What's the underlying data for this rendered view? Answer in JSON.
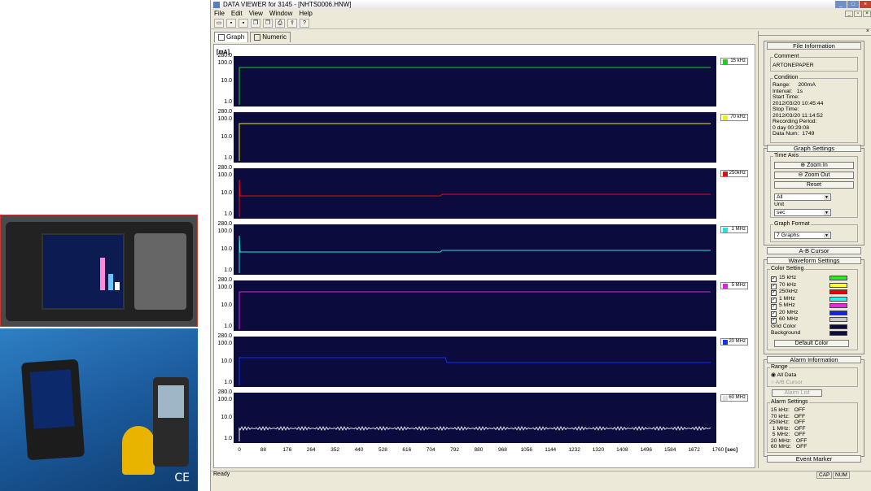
{
  "window": {
    "title": "DATA VIEWER for 3145 - [NHTS0006.HNW]"
  },
  "menu": [
    "File",
    "Edit",
    "View",
    "Window",
    "Help"
  ],
  "tabs": [
    {
      "label": "Graph"
    },
    {
      "label": "Numeric"
    }
  ],
  "graph": {
    "unit": "[mA]",
    "y_ticks": [
      "280.0",
      "100.0",
      "10.0",
      "1.0"
    ],
    "x_ticks": [
      "0",
      "88",
      "176",
      "264",
      "352",
      "440",
      "528",
      "616",
      "704",
      "792",
      "880",
      "968",
      "1056",
      "1144",
      "1232",
      "1320",
      "1408",
      "1496",
      "1584",
      "1672",
      "1760"
    ],
    "x_unit": "[sec]",
    "channels": [
      {
        "label": "15 kHz",
        "color": "#22cc22"
      },
      {
        "label": "70 kHz",
        "color": "#eeee22"
      },
      {
        "label": "250kHz",
        "color": "#dd1111"
      },
      {
        "label": "1 MHz",
        "color": "#33dddd"
      },
      {
        "label": "5 MHz",
        "color": "#dd22dd"
      },
      {
        "label": "20 MHz",
        "color": "#1133ee"
      },
      {
        "label": "60 MHz",
        "color": "#e0e0e0"
      }
    ]
  },
  "file_info": {
    "title": "File Information",
    "comment_label": "Comment",
    "comment": "ARTONEPAPER",
    "condition_label": "Condition",
    "lines": [
      "Range:     200mA",
      "Interval:   1s",
      "Start Time:",
      "2012/03/20 10:45:44",
      "Stop Time:",
      "2012/03/20 11:14:52",
      "Recording Period:",
      "0 day 00:29:08",
      "Data Num:  1749"
    ]
  },
  "graph_settings": {
    "title": "Graph Settings",
    "time_axis": "Time Axis",
    "zoom_in": "Zoom In",
    "zoom_out": "Zoom Out",
    "reset": "Reset",
    "range_value": "All",
    "unit_label": "Unit",
    "unit_value": "sec",
    "format_label": "Graph Format",
    "format_value": "7 Graphs"
  },
  "ab_cursor": "A-B Cursor",
  "waveform": {
    "title": "Waveform Settings",
    "color_setting": "Color Setting",
    "items": [
      "15 kHz",
      "70 kHz",
      "250kHz",
      "1 MHz",
      "5 MHz",
      "20 MHz",
      "60 MHz"
    ],
    "item_colors": [
      "#22ee22",
      "#ffff22",
      "#ee0000",
      "#33eeee",
      "#ee22ee",
      "#1122ee",
      "#c8c8c8"
    ],
    "grid_color": "Grid Color",
    "background": "Background",
    "default_color": "Default Color"
  },
  "alarm": {
    "title": "Alarm Information",
    "range_label": "Range",
    "all_data": "All Data",
    "ab_cursor": "A/B Cursor",
    "alarm_list": "Alarm List",
    "settings_label": "Alarm Settings",
    "lines": [
      " 15 kHz:   OFF",
      " 70 kHz:   OFF",
      "250kHz:   OFF",
      "  1 MHz:   OFF",
      "  5 MHz:   OFF",
      " 20 MHz:   OFF",
      " 60 MHz:   OFF"
    ]
  },
  "event_marker": "Event Marker",
  "status": {
    "text": "Ready",
    "cap": "CAP",
    "num": "NUM"
  }
}
